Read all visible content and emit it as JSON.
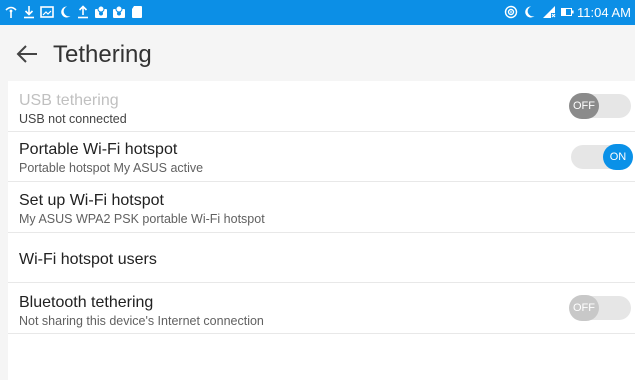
{
  "status_bar": {
    "time": "11:04 AM",
    "left_icons": [
      "wifi-tether-icon",
      "download-icon",
      "image-icon",
      "moon-icon",
      "upload-icon",
      "badge-icon",
      "badge-icon",
      "sd-card-icon"
    ],
    "right_icons": [
      "hotspot-icon",
      "moon-icon",
      "signal-icon",
      "battery-icon"
    ],
    "color": "#0c8fe6"
  },
  "toolbar": {
    "title": "Tethering"
  },
  "settings": [
    {
      "title": "USB tethering",
      "subtitle": "USB not connected",
      "toggle": "OFF",
      "enabled": false
    },
    {
      "title": "Portable Wi-Fi hotspot",
      "subtitle": "Portable hotspot My ASUS active",
      "toggle": "ON",
      "enabled": true
    },
    {
      "title": "Set up Wi-Fi hotspot",
      "subtitle": "My ASUS WPA2 PSK portable Wi-Fi hotspot"
    },
    {
      "title": "Wi-Fi hotspot users"
    },
    {
      "title": "Bluetooth tethering",
      "subtitle": "Not sharing this device's Internet connection",
      "toggle": "OFF",
      "enabled": true
    }
  ],
  "accent": "#0a91e8"
}
